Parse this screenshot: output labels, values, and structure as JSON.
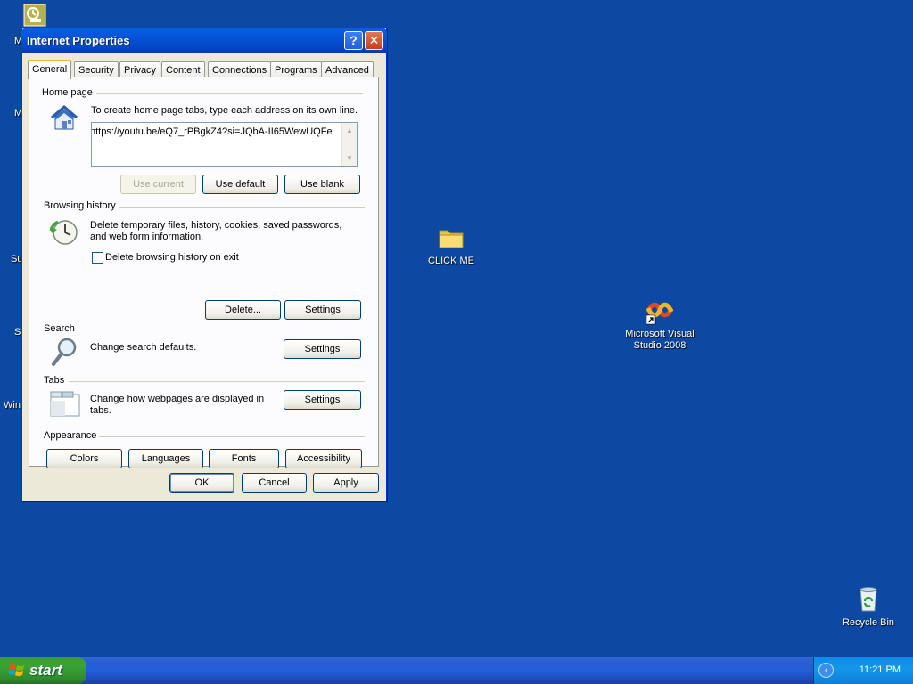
{
  "desktop": {
    "icons": [
      {
        "label": "CLICK ME"
      },
      {
        "label": "Microsoft Visual Studio 2008"
      },
      {
        "label": "Recycle Bin"
      }
    ],
    "partial_labels": [
      "M",
      "M",
      "Su",
      "S",
      "Win"
    ]
  },
  "dialog": {
    "title": "Internet Properties",
    "help_glyph": "?",
    "close_glyph": "✕",
    "tabs": [
      "General",
      "Security",
      "Privacy",
      "Content",
      "Connections",
      "Programs",
      "Advanced"
    ],
    "home_page": {
      "title": "Home page",
      "desc": "To create home page tabs, type each address on its own line.",
      "url": "https://youtu.be/eQ7_rPBgkZ4?si=JQbA-II65WewUQFe",
      "use_current": "Use current",
      "use_default": "Use default",
      "use_blank": "Use blank"
    },
    "browsing_history": {
      "title": "Browsing history",
      "desc_line1": "Delete temporary files, history, cookies, saved passwords,",
      "desc_line2": "and web form information.",
      "checkbox_label": "Delete browsing history on exit",
      "delete": "Delete...",
      "settings": "Settings"
    },
    "search": {
      "title": "Search",
      "desc": "Change search defaults.",
      "settings": "Settings"
    },
    "tabs_section": {
      "title": "Tabs",
      "desc_line1": "Change how webpages are displayed in",
      "desc_line2": "tabs.",
      "settings": "Settings"
    },
    "appearance": {
      "title": "Appearance",
      "colors": "Colors",
      "languages": "Languages",
      "fonts": "Fonts",
      "accessibility": "Accessibility"
    },
    "footer": {
      "ok": "OK",
      "cancel": "Cancel",
      "apply": "Apply"
    }
  },
  "taskbar": {
    "start_label": "start",
    "clock": "11:21 PM"
  }
}
